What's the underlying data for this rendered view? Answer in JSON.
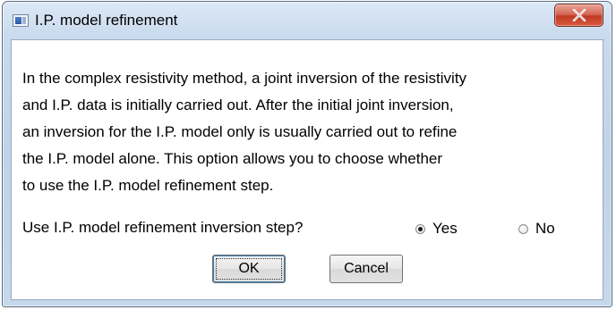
{
  "window": {
    "title": "I.P. model refinement",
    "close_glyph": "X"
  },
  "message": {
    "lines": [
      "In the complex resistivity method, a joint inversion of the resistivity",
      "and I.P. data is initially carried out. After the initial joint inversion,",
      "an inversion for the I.P. model only is usually carried out to refine",
      "the I.P. model alone. This option allows you to choose whether",
      "to use the I.P. model refinement step."
    ]
  },
  "question": {
    "label": "Use I.P. model refinement inversion step?",
    "options": [
      {
        "label": "Yes",
        "selected": true
      },
      {
        "label": "No",
        "selected": false
      }
    ]
  },
  "buttons": {
    "ok_label": "OK",
    "cancel_label": "Cancel"
  },
  "colors": {
    "titlebar": "#c6d8ec",
    "close_button": "#c94a34",
    "client_background": "#ffffff"
  },
  "icons": {
    "app": "window-app-icon",
    "close": "close-icon"
  }
}
